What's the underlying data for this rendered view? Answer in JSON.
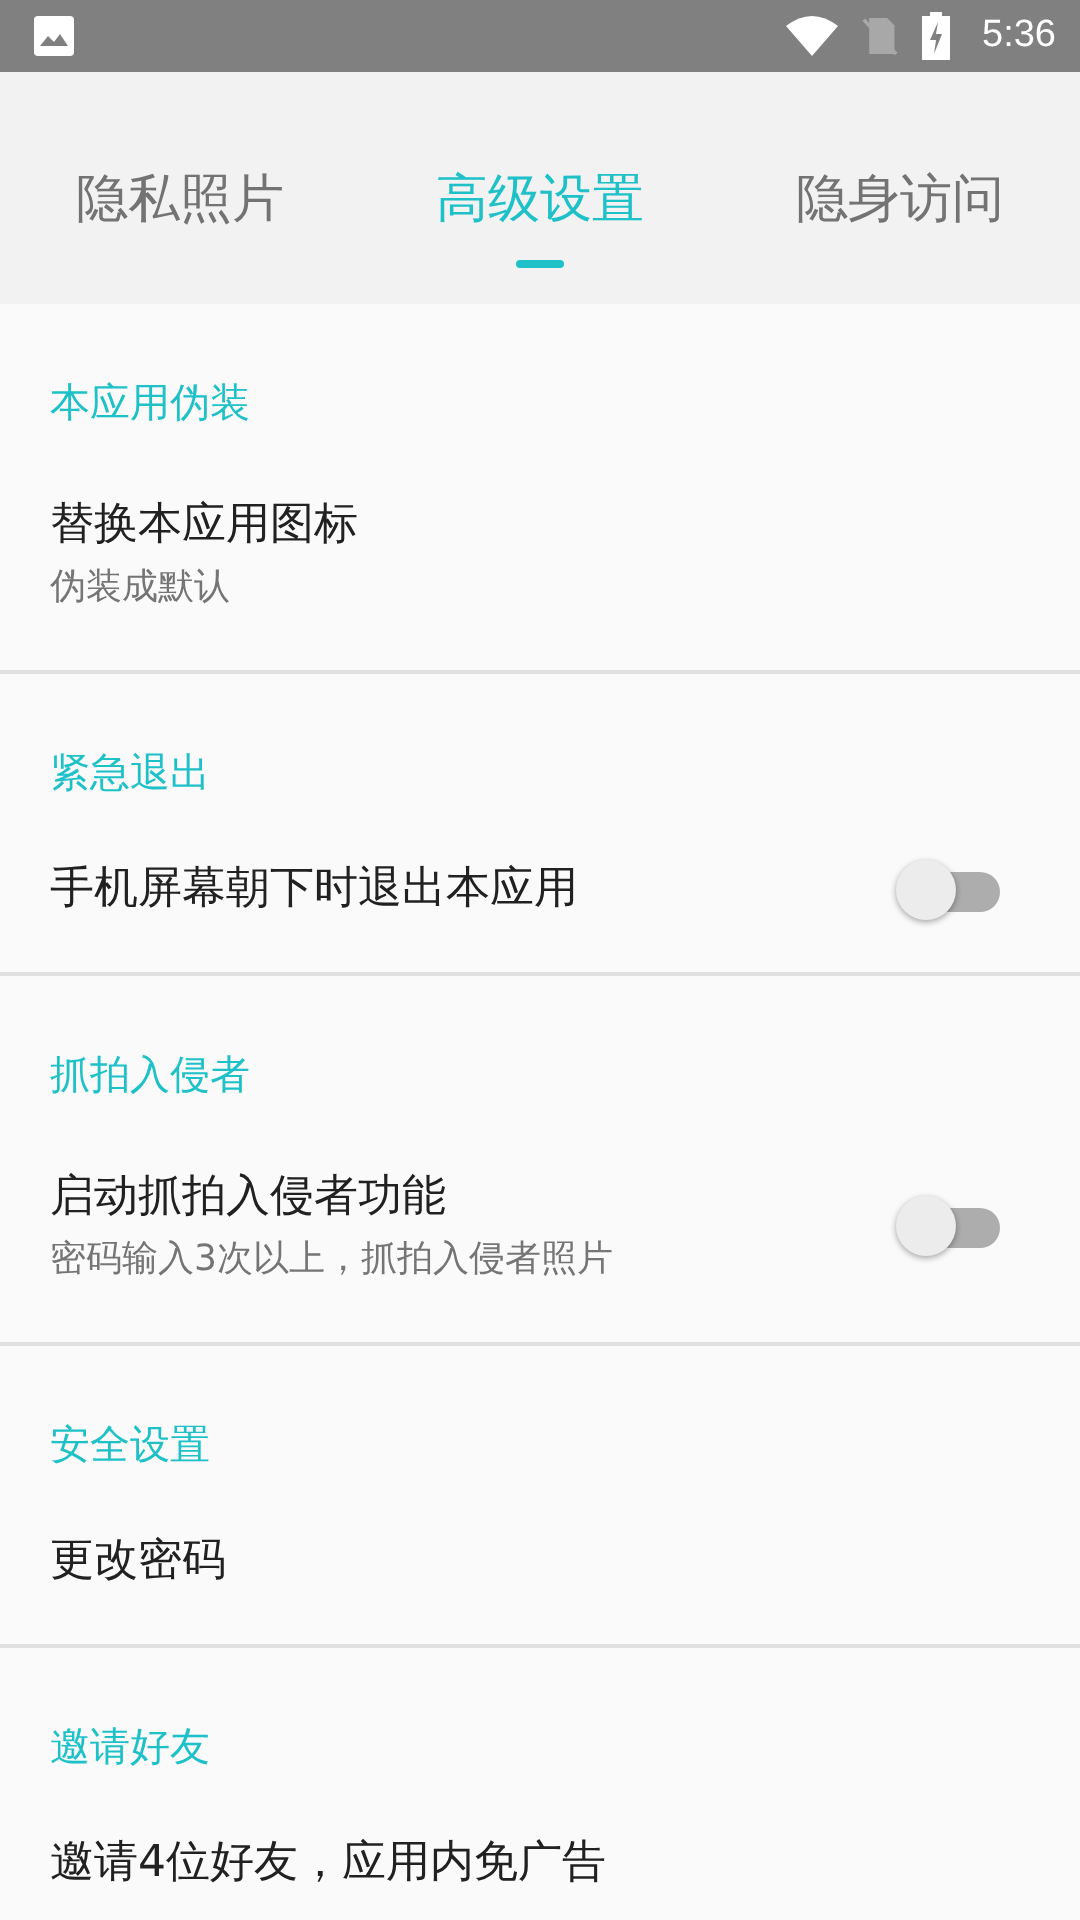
{
  "status_bar": {
    "time": "5:36"
  },
  "tabs": [
    {
      "label": "隐私照片",
      "selected": false
    },
    {
      "label": "高级设置",
      "selected": true
    },
    {
      "label": "隐身访问",
      "selected": false
    }
  ],
  "sections": [
    {
      "header": "本应用伪装",
      "items": [
        {
          "kind": "link",
          "title": "替换本应用图标",
          "subtitle": "伪装成默认"
        }
      ]
    },
    {
      "header": "紧急退出",
      "items": [
        {
          "kind": "toggle",
          "title": "手机屏幕朝下时退出本应用",
          "on": false
        }
      ]
    },
    {
      "header": "抓拍入侵者",
      "items": [
        {
          "kind": "toggle",
          "title": "启动抓拍入侵者功能",
          "subtitle": "密码输入3次以上，抓拍入侵者照片",
          "on": false
        }
      ]
    },
    {
      "header": "安全设置",
      "items": [
        {
          "kind": "link",
          "title": "更改密码"
        }
      ]
    },
    {
      "header": "邀请好友",
      "items": [
        {
          "kind": "link",
          "title": "邀请4位好友，应用内免广告"
        }
      ]
    }
  ]
}
